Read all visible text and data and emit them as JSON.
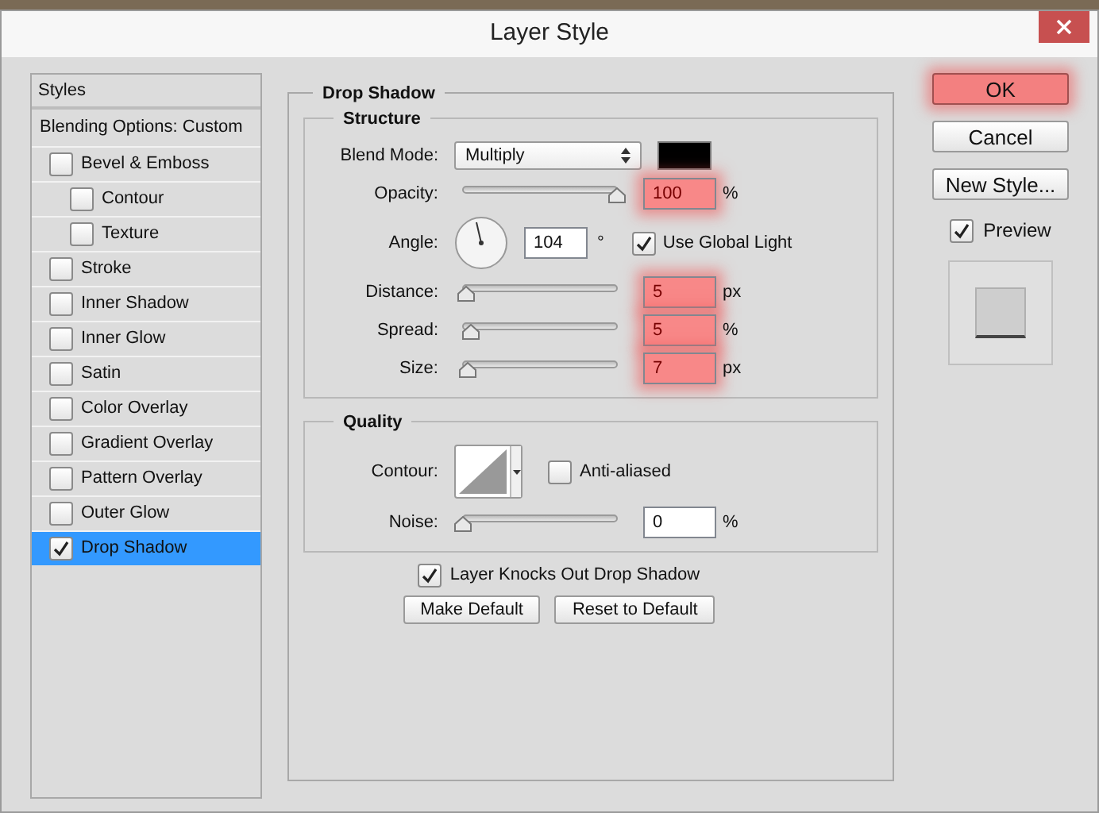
{
  "window": {
    "title": "Layer Style"
  },
  "styles_panel": {
    "header": "Styles",
    "blending_options": "Blending Options: Custom",
    "items": [
      {
        "label": "Bevel & Emboss",
        "checked": false,
        "selected": false,
        "children": [
          {
            "label": "Contour",
            "checked": false,
            "selected": false
          },
          {
            "label": "Texture",
            "checked": false,
            "selected": false
          }
        ]
      },
      {
        "label": "Stroke",
        "checked": false,
        "selected": false
      },
      {
        "label": "Inner Shadow",
        "checked": false,
        "selected": false
      },
      {
        "label": "Inner Glow",
        "checked": false,
        "selected": false
      },
      {
        "label": "Satin",
        "checked": false,
        "selected": false
      },
      {
        "label": "Color Overlay",
        "checked": false,
        "selected": false
      },
      {
        "label": "Gradient Overlay",
        "checked": false,
        "selected": false
      },
      {
        "label": "Pattern Overlay",
        "checked": false,
        "selected": false
      },
      {
        "label": "Outer Glow",
        "checked": false,
        "selected": false
      },
      {
        "label": "Drop Shadow",
        "checked": true,
        "selected": true
      }
    ]
  },
  "drop_shadow": {
    "title": "Drop Shadow",
    "structure": {
      "title": "Structure",
      "blend_mode": {
        "label": "Blend Mode:",
        "value": "Multiply",
        "color": "#000000"
      },
      "opacity": {
        "label": "Opacity:",
        "value": "100",
        "unit": "%",
        "level": 1,
        "highlighted": true
      },
      "angle": {
        "label": "Angle:",
        "value": "104",
        "unit": "°"
      },
      "use_global_light": {
        "label": "Use Global Light",
        "checked": true
      },
      "sliders": [
        {
          "label": "Distance:",
          "value": "5",
          "unit": "px",
          "level": 0.02,
          "highlighted": true
        },
        {
          "label": "Spread:",
          "value": "5",
          "unit": "%",
          "level": 0.05,
          "highlighted": true
        },
        {
          "label": "Size:",
          "value": "7",
          "unit": "px",
          "level": 0.03,
          "highlighted": true
        }
      ]
    },
    "quality": {
      "title": "Quality",
      "contour_label": "Contour:",
      "anti_aliased": {
        "label": "Anti-aliased",
        "checked": false
      },
      "noise": {
        "label": "Noise:",
        "value": "0",
        "unit": "%",
        "level": 0,
        "highlighted": false
      }
    },
    "layer_knocks_out": {
      "label": "Layer Knocks Out Drop Shadow",
      "checked": true
    },
    "buttons": [
      "Make Default",
      "Reset to Default"
    ]
  },
  "actions": [
    {
      "label": "OK",
      "highlighted": true
    },
    {
      "label": "Cancel",
      "highlighted": false
    },
    {
      "label": "New Style...",
      "highlighted": false
    }
  ],
  "preview": {
    "label": "Preview",
    "checked": true
  }
}
